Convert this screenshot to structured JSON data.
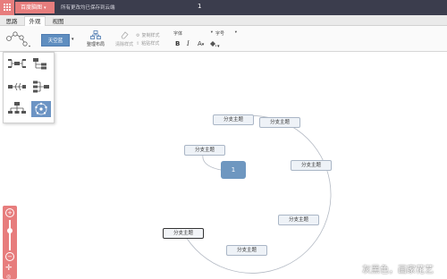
{
  "titlebar": {
    "app_menu_label": "百度脑图",
    "save_status": "所有更改均已保存到云端",
    "doc_title": "1"
  },
  "tabs": [
    {
      "label": "思路",
      "active": false
    },
    {
      "label": "外观",
      "active": true
    },
    {
      "label": "视图",
      "active": false
    }
  ],
  "toolbar": {
    "theme_label": "天空蓝",
    "relayout_label": "整理布局",
    "clear_style_label": "清除样式",
    "copy_style_label": "复制样式",
    "paste_style_label": "粘贴样式",
    "font_label": "字体",
    "size_label": "字号",
    "bold_label": "B",
    "italic_label": "I",
    "font_color_label": "A",
    "bg_color_icon": "fill-bucket-icon"
  },
  "structure_panel": {
    "options": [
      "mind-map",
      "logical-structure",
      "fish-bone",
      "org-chart",
      "tree",
      "radial"
    ],
    "selected": "radial"
  },
  "mindmap": {
    "center_label": "1",
    "branches": [
      "分支主题",
      "分支主题",
      "分支主题",
      "分支主题",
      "分支主题",
      "分支主题",
      "分支主题"
    ],
    "selected_branch": 5
  },
  "zoom": {
    "zoom_in": "+",
    "zoom_out": "−",
    "move_icon": "move-icon",
    "fit_icon": "fit-icon"
  },
  "watermark": "灰黑色，画家花艺",
  "colors": {
    "titlebar_bg": "#3b3d4d",
    "accent_red": "#e77d7d",
    "theme_blue": "#5f8ec0",
    "center_node": "#6e97c0"
  }
}
